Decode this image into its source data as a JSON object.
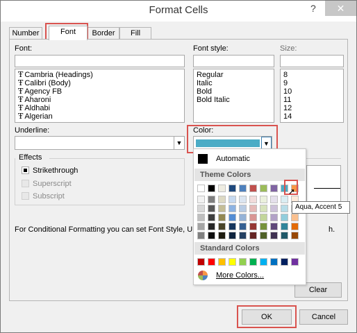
{
  "window": {
    "title": "Format Cells",
    "help": "?",
    "close": "✕"
  },
  "tabs": [
    "Number",
    "Font",
    "Border",
    "Fill"
  ],
  "font": {
    "label": "Font:",
    "value": "",
    "items": [
      "Cambria (Headings)",
      "Calibri (Body)",
      "Agency FB",
      "Aharoni",
      "Aldhabi",
      "Algerian"
    ]
  },
  "font_style": {
    "label": "Font style:",
    "value": "",
    "items": [
      "Regular",
      "Italic",
      "Bold",
      "Bold Italic"
    ]
  },
  "size": {
    "label": "Size:",
    "value": "",
    "items": [
      "8",
      "9",
      "10",
      "11",
      "12",
      "14"
    ]
  },
  "underline": {
    "label": "Underline:",
    "value": ""
  },
  "color": {
    "label": "Color:",
    "value_color": "#4bacc6"
  },
  "effects": {
    "label": "Effects",
    "strikethrough": "Strikethrough",
    "superscript": "Superscript",
    "subscript": "Subscript"
  },
  "info_text": "For Conditional Formatting you can set Font Style, U",
  "info_tail": "h.",
  "palette": {
    "automatic": "Automatic",
    "theme_colors": "Theme Colors",
    "standard_colors": "Standard Colors",
    "more_colors": "More Colors...",
    "theme_top": [
      "#ffffff",
      "#000000",
      "#eeece1",
      "#1f497d",
      "#4f81bd",
      "#c0504d",
      "#9bbb59",
      "#8064a2",
      "#4bacc6",
      "#f79646"
    ],
    "theme_shades": [
      [
        "#f2f2f2",
        "#7f7f7f",
        "#ddd9c3",
        "#c6d9f0",
        "#dbe5f1",
        "#f2dcdb",
        "#ebf1dd",
        "#e5e0ec",
        "#dbeef3",
        "#fdeada"
      ],
      [
        "#d8d8d8",
        "#595959",
        "#c4bd97",
        "#8db3e2",
        "#b8cce4",
        "#e5b9b7",
        "#d7e3bc",
        "#ccc1d9",
        "#b7dde8",
        "#fbd5b5"
      ],
      [
        "#bfbfbf",
        "#3f3f3f",
        "#938953",
        "#548dd4",
        "#95b3d7",
        "#d99694",
        "#c3d69b",
        "#b2a2c7",
        "#92cddc",
        "#fac08f"
      ],
      [
        "#a5a5a5",
        "#262626",
        "#494429",
        "#17365d",
        "#366092",
        "#953734",
        "#76923c",
        "#5f497a",
        "#31859b",
        "#e36c09"
      ],
      [
        "#7f7f7f",
        "#0c0c0c",
        "#1d1b10",
        "#0f243e",
        "#244061",
        "#632423",
        "#4f6128",
        "#3f3151",
        "#205867",
        "#974806"
      ]
    ],
    "standard": [
      "#c00000",
      "#ff0000",
      "#ffc000",
      "#ffff00",
      "#92d050",
      "#00b050",
      "#00b0f0",
      "#0070c0",
      "#002060",
      "#7030a0"
    ]
  },
  "tooltip": "Aqua, Accent 5",
  "buttons": {
    "clear": "Clear",
    "ok": "OK",
    "cancel": "Cancel"
  }
}
